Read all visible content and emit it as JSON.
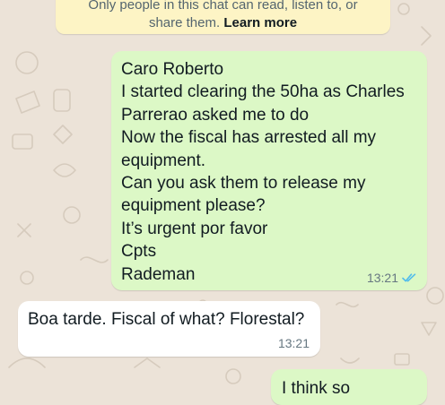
{
  "encryption_notice": {
    "line1": "Only people in this chat can read, listen to, or",
    "line2_prefix": "share them.",
    "learn_more": "Learn more"
  },
  "messages": [
    {
      "direction": "outgoing",
      "lines": [
        "Caro Roberto",
        "I started clearing the 50ha as Charles",
        "Parrerao asked me to do",
        "Now the fiscal has arrested all my",
        "equipment.",
        "Can you ask them to release my",
        "equipment please?",
        "It’s urgent por favor",
        "Cpts",
        "Rademan"
      ],
      "time": "13:21",
      "status_icon": "double-check-read-icon"
    },
    {
      "direction": "incoming",
      "lines": [
        "Boa tarde. Fiscal of what? Florestal?"
      ],
      "time": "13:21"
    },
    {
      "direction": "outgoing",
      "lines": [
        "I think so"
      ]
    }
  ],
  "colors": {
    "background": "#ece3d8",
    "outgoing_bubble": "#dcf8c6",
    "incoming_bubble": "#ffffff",
    "notice_bg": "#fdf4c5",
    "read_tick": "#53bdeb",
    "timestamp": "#667781"
  }
}
